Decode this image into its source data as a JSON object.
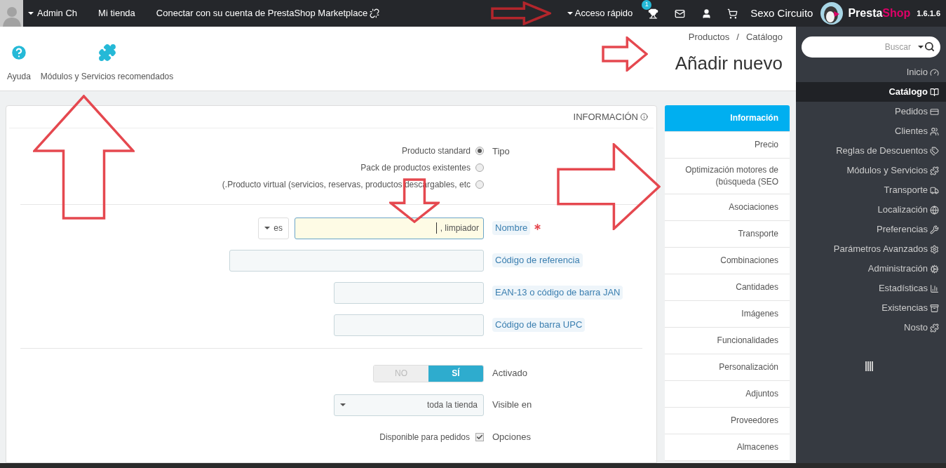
{
  "top_bar": {
    "user_menu": "Admin Ch",
    "links": [
      "Mi tienda",
      "Conectar con su cuenta de PrestaShop Marketplace"
    ],
    "quick_access": "Acceso rápido",
    "notification_count": "1",
    "shop_name": "Sexo Circuito",
    "logo": {
      "first": "Presta",
      "second": "Shop"
    },
    "version": "1.6.1.6"
  },
  "toolbar": [
    {
      "label": "Ayuda",
      "kind": "help"
    },
    {
      "label": "Módulos y Servicios recomendados",
      "kind": "modules"
    }
  ],
  "breadcrumb": [
    "Productos",
    "Catálogo"
  ],
  "breadcrumb_separator": "/",
  "page_title": "Añadir nuevo",
  "search": {
    "placeholder": "Buscar"
  },
  "sidebar": [
    {
      "label": "Inicio",
      "kind": "dashboard",
      "selected": false
    },
    {
      "label": "Catálogo",
      "kind": "book",
      "selected": true
    },
    {
      "label": "Pedidos",
      "kind": "card",
      "selected": false
    },
    {
      "label": "Clientes",
      "kind": "users",
      "selected": false
    },
    {
      "label": "Reglas de Descuentos",
      "kind": "tags",
      "selected": false
    },
    {
      "label": "Módulos y Servicios",
      "kind": "puzzle",
      "selected": false
    },
    {
      "label": "Transporte",
      "kind": "truck",
      "selected": false
    },
    {
      "label": "Localización",
      "kind": "globe",
      "selected": false
    },
    {
      "label": "Preferencias",
      "kind": "wrench",
      "selected": false
    },
    {
      "label": "Parámetros Avanzados",
      "kind": "cogs",
      "selected": false
    },
    {
      "label": "Administración",
      "kind": "cog",
      "selected": false
    },
    {
      "label": "Estadísticas",
      "kind": "chart",
      "selected": false
    },
    {
      "label": "Existencias",
      "kind": "archive",
      "selected": false
    },
    {
      "label": "Nosto",
      "kind": "puzzle",
      "selected": false
    }
  ],
  "form": {
    "title": "INFORMACIÓN",
    "type_label": "Tipo",
    "types": [
      {
        "label": "Producto standard",
        "selected": true
      },
      {
        "label": "Pack de productos existentes",
        "selected": false
      },
      {
        "label": "(.Producto virtual (servicios, reservas, productos descargables, etc",
        "selected": false
      }
    ],
    "name": {
      "language": "es",
      "value": ", limpiador",
      "label": "Nombre",
      "required": true
    },
    "fields": [
      {
        "label": "Código de referencia",
        "kind": "long"
      },
      {
        "label": "EAN-13 o código de barra JAN",
        "kind": "short"
      },
      {
        "label": "Código de barra UPC",
        "kind": "short"
      }
    ],
    "active": {
      "label": "Activado",
      "options": [
        {
          "label": "NO",
          "selected": false
        },
        {
          "label": "SÍ",
          "selected": true
        }
      ]
    },
    "visibility": {
      "label": "Visible en",
      "value": "toda la tienda"
    },
    "options": {
      "label": "Opciones",
      "items": [
        {
          "label": "Disponible para pedidos",
          "checked": true
        }
      ]
    }
  },
  "tabs": [
    {
      "label": "Información",
      "selected": true
    },
    {
      "label": "Precio",
      "selected": false
    },
    {
      "label": "Optimización motores de (búsqueda (SEO",
      "selected": false
    },
    {
      "label": "Asociaciones",
      "selected": false
    },
    {
      "label": "Transporte",
      "selected": false
    },
    {
      "label": "Combinaciones",
      "selected": false
    },
    {
      "label": "Cantidades",
      "selected": false
    },
    {
      "label": "Imágenes",
      "selected": false
    },
    {
      "label": "Funcionalidades",
      "selected": false
    },
    {
      "label": "Personalización",
      "selected": false
    },
    {
      "label": "Adjuntos",
      "selected": false
    },
    {
      "label": "Proveedores",
      "selected": false
    },
    {
      "label": "Almacenes",
      "selected": false
    }
  ]
}
